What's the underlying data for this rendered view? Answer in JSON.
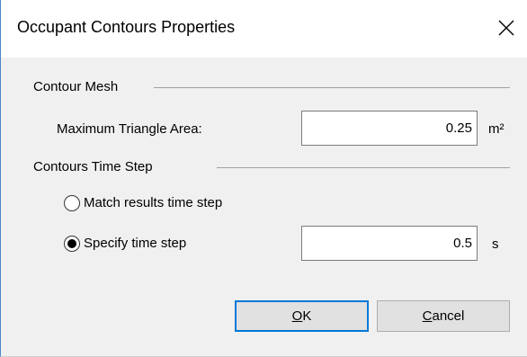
{
  "window": {
    "title": "Occupant Contours Properties"
  },
  "contour_mesh": {
    "group_label": "Contour Mesh",
    "max_triangle_area_label": "Maximum Triangle Area:",
    "max_triangle_area_value": "0.25",
    "max_triangle_area_unit": "m²"
  },
  "time_step": {
    "group_label": "Contours Time Step",
    "options": [
      {
        "label": "Match results time step",
        "selected": false
      },
      {
        "label": "Specify time step",
        "selected": true
      }
    ],
    "value": "0.5",
    "unit": "s"
  },
  "buttons": {
    "ok": {
      "mnemonic": "O",
      "rest": "K"
    },
    "cancel": {
      "mnemonic": "C",
      "rest": "ancel"
    }
  },
  "icons": {
    "close": "close-icon"
  },
  "colors": {
    "dialog_background": "#f0f0f0",
    "default_button_border": "#0078d7",
    "button_face": "#e1e1e1",
    "window_border": "#4b88c9"
  }
}
